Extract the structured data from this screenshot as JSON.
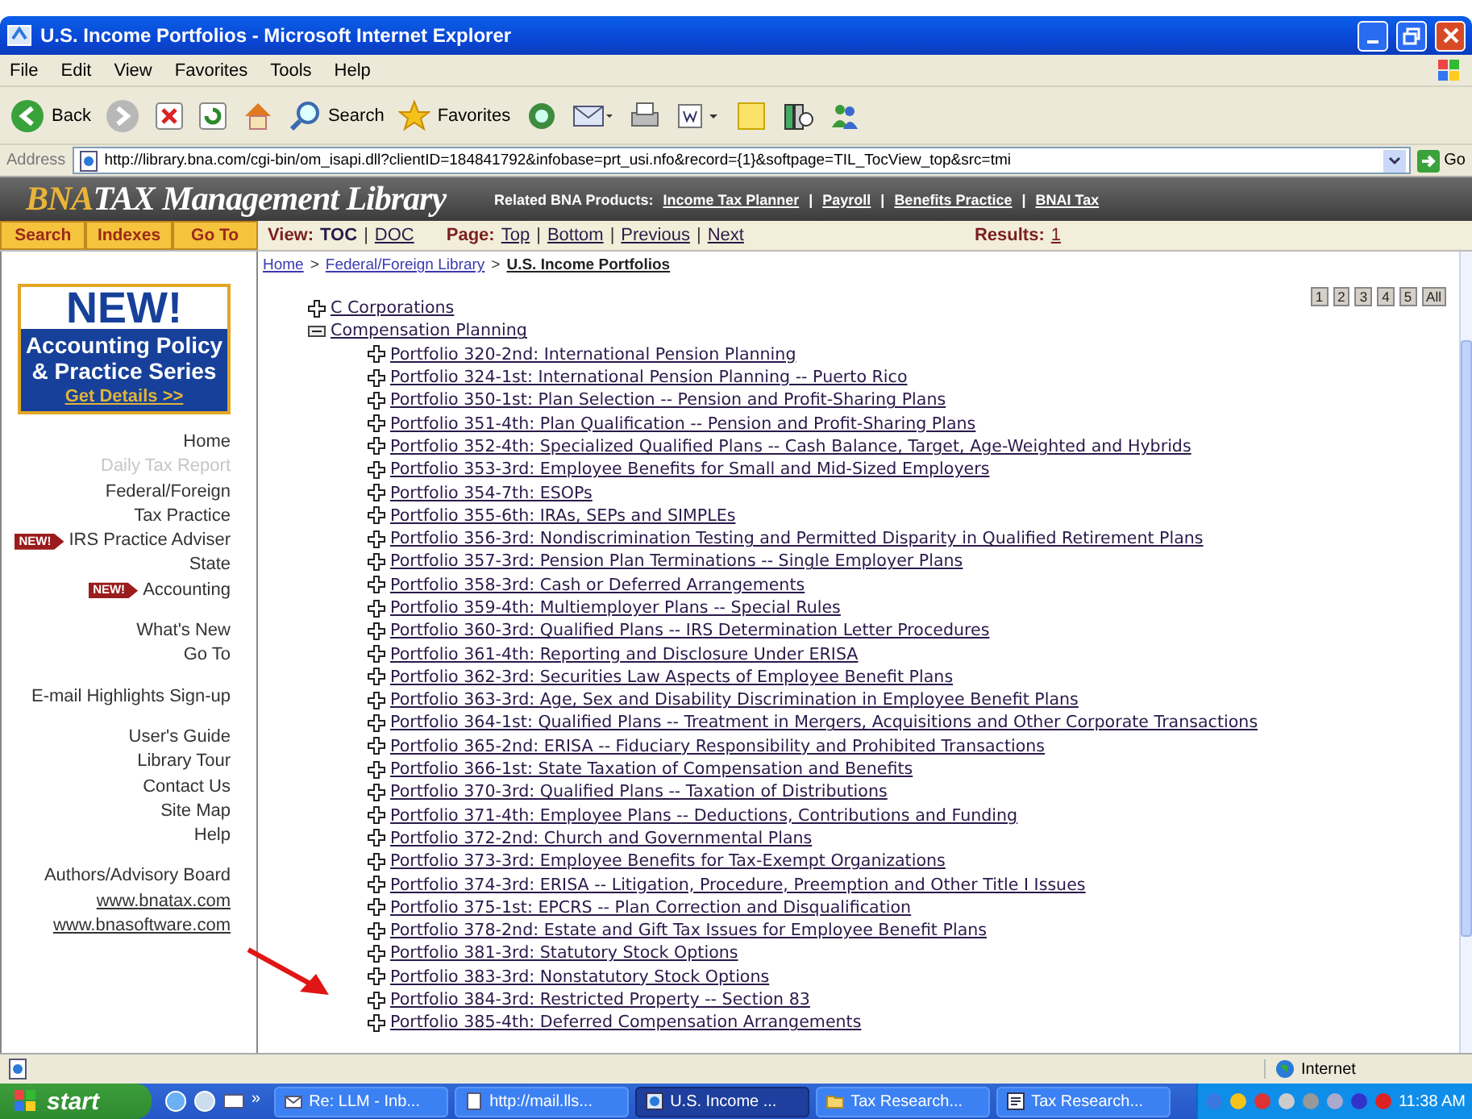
{
  "window": {
    "title": "U.S. Income Portfolios - Microsoft Internet Explorer"
  },
  "menu_bar": [
    "File",
    "Edit",
    "View",
    "Favorites",
    "Tools",
    "Help"
  ],
  "toolbar": [
    {
      "kind": "back",
      "label": "Back"
    },
    {
      "kind": "forward"
    },
    {
      "kind": "stop"
    },
    {
      "kind": "refresh"
    },
    {
      "kind": "home"
    },
    {
      "kind": "search",
      "label": "Search"
    },
    {
      "kind": "favorites",
      "label": "Favorites"
    },
    {
      "kind": "media"
    },
    {
      "kind": "mail"
    },
    {
      "kind": "print"
    },
    {
      "kind": "edit"
    },
    {
      "kind": "discuss"
    },
    {
      "kind": "research"
    },
    {
      "kind": "messenger"
    }
  ],
  "address_bar": {
    "label": "Address",
    "value": "http://library.bna.com/cgi-bin/om_isapi.dll?clientID=184841792&infobase=prt_usi.nfo&record={1}&softpage=TIL_TocView_top&src=tmi",
    "go": "Go"
  },
  "header": {
    "logo_brand": "BNA",
    "logo_name": "TAX Management Library",
    "related_label": "Related BNA Products:",
    "related_links": [
      "Income Tax Planner",
      "Payroll",
      "Benefits Practice",
      "BNAI Tax"
    ],
    "separator": "|"
  },
  "nav_bar": {
    "buttons": [
      "Search",
      "Indexes",
      "Go To"
    ],
    "view_label": "View:",
    "views": [
      {
        "label": "TOC",
        "selected": true
      },
      {
        "label": "DOC",
        "selected": false
      }
    ],
    "page_label": "Page:",
    "page_links": [
      "Top",
      "Bottom",
      "Previous",
      "Next"
    ],
    "separator": "|",
    "results_label": "Results:",
    "results_value": "1"
  },
  "breadcrumb": {
    "items": [
      "Home",
      "Federal/Foreign Library",
      "U.S. Income Portfolios"
    ],
    "separator": ">"
  },
  "sidebar": {
    "promo": {
      "headline": "NEW!",
      "title": "Accounting Policy & Practice Series",
      "link": "Get Details >>"
    },
    "groups": [
      [
        {
          "label": "Home",
          "disabled": false
        },
        {
          "label": "Daily Tax Report",
          "disabled": true
        },
        {
          "label": "Federal/Foreign",
          "disabled": false
        },
        {
          "label": "Tax Practice",
          "disabled": false
        },
        {
          "label": "IRS Practice Adviser",
          "disabled": false,
          "badge": "NEW!"
        },
        {
          "label": "State",
          "disabled": false
        },
        {
          "label": "Accounting",
          "disabled": false,
          "badge": "NEW!"
        }
      ],
      [
        {
          "label": "What's New",
          "disabled": false
        },
        {
          "label": "Go To",
          "disabled": false
        }
      ],
      [
        {
          "label": "E-mail Highlights Sign-up",
          "disabled": false
        }
      ],
      [
        {
          "label": "User's Guide",
          "disabled": false
        },
        {
          "label": "Library Tour",
          "disabled": false
        },
        {
          "label": "Contact Us",
          "disabled": false
        },
        {
          "label": "Site Map",
          "disabled": false
        },
        {
          "label": "Help",
          "disabled": false
        }
      ],
      [
        {
          "label": "Authors/Advisory Board",
          "disabled": false
        },
        {
          "label": "www.bnatax.com",
          "disabled": false,
          "kind": "link"
        },
        {
          "label": "www.bnasoftware.com",
          "disabled": false,
          "kind": "link"
        }
      ]
    ]
  },
  "page_numbers": [
    "1",
    "2",
    "3",
    "4",
    "5",
    "All"
  ],
  "tree": [
    {
      "label": "C Corporations",
      "expanded": false
    },
    {
      "label": "Compensation Planning",
      "expanded": true,
      "children": [
        {
          "label": "Portfolio 320-2nd: International Pension Planning",
          "expanded": false
        },
        {
          "label": "Portfolio 324-1st: International Pension Planning -- Puerto Rico",
          "expanded": false
        },
        {
          "label": "Portfolio 350-1st: Plan Selection -- Pension and Profit-Sharing Plans",
          "expanded": false
        },
        {
          "label": "Portfolio 351-4th: Plan Qualification -- Pension and Profit-Sharing Plans",
          "expanded": false
        },
        {
          "label": "Portfolio 352-4th: Specialized Qualified Plans -- Cash Balance, Target, Age-Weighted and Hybrids",
          "expanded": false
        },
        {
          "label": "Portfolio 353-3rd: Employee Benefits for Small and Mid-Sized Employers",
          "expanded": false
        },
        {
          "label": "Portfolio 354-7th: ESOPs",
          "expanded": false
        },
        {
          "label": "Portfolio 355-6th: IRAs, SEPs and SIMPLEs",
          "expanded": false
        },
        {
          "label": "Portfolio 356-3rd: Nondiscrimination Testing and Permitted Disparity in Qualified Retirement Plans",
          "expanded": false
        },
        {
          "label": "Portfolio 357-3rd: Pension Plan Terminations -- Single Employer Plans",
          "expanded": false
        },
        {
          "label": "Portfolio 358-3rd: Cash or Deferred Arrangements",
          "expanded": false
        },
        {
          "label": "Portfolio 359-4th: Multiemployer Plans -- Special Rules",
          "expanded": false
        },
        {
          "label": "Portfolio 360-3rd: Qualified Plans -- IRS Determination Letter Procedures",
          "expanded": false
        },
        {
          "label": "Portfolio 361-4th: Reporting and Disclosure Under ERISA",
          "expanded": false
        },
        {
          "label": "Portfolio 362-3rd: Securities Law Aspects of Employee Benefit Plans",
          "expanded": false
        },
        {
          "label": "Portfolio 363-3rd: Age, Sex and Disability Discrimination in Employee Benefit Plans",
          "expanded": false
        },
        {
          "label": "Portfolio 364-1st: Qualified Plans -- Treatment in Mergers, Acquisitions and Other Corporate Transactions",
          "expanded": false
        },
        {
          "label": "Portfolio 365-2nd: ERISA -- Fiduciary Responsibility and Prohibited Transactions",
          "expanded": false
        },
        {
          "label": "Portfolio 366-1st: State Taxation of Compensation and Benefits",
          "expanded": false
        },
        {
          "label": "Portfolio 370-3rd: Qualified Plans -- Taxation of Distributions",
          "expanded": false
        },
        {
          "label": "Portfolio 371-4th: Employee Plans -- Deductions, Contributions and Funding",
          "expanded": false
        },
        {
          "label": "Portfolio 372-2nd: Church and Governmental Plans",
          "expanded": false
        },
        {
          "label": "Portfolio 373-3rd: Employee Benefits for Tax-Exempt Organizations",
          "expanded": false
        },
        {
          "label": "Portfolio 374-3rd: ERISA -- Litigation, Procedure, Preemption and Other Title I Issues",
          "expanded": false
        },
        {
          "label": "Portfolio 375-1st: EPCRS -- Plan Correction and Disqualification",
          "expanded": false
        },
        {
          "label": "Portfolio 378-2nd: Estate and Gift Tax Issues for Employee Benefit Plans",
          "expanded": false
        },
        {
          "label": "Portfolio 381-3rd: Statutory Stock Options",
          "expanded": false
        },
        {
          "label": "Portfolio 383-3rd: Nonstatutory Stock Options",
          "expanded": false
        },
        {
          "label": "Portfolio 384-3rd: Restricted Property -- Section 83",
          "expanded": false
        },
        {
          "label": "Portfolio 385-4th: Deferred Compensation Arrangements",
          "expanded": false
        }
      ]
    }
  ],
  "status_bar": {
    "zone": "Internet"
  },
  "taskbar": {
    "start": "start",
    "more": "»",
    "tasks": [
      {
        "label": "Re: LLM - Inb...",
        "kind": "mail",
        "selected": false
      },
      {
        "label": "http://mail.lls...",
        "kind": "page",
        "selected": false
      },
      {
        "label": "U.S. Income ...",
        "kind": "ie",
        "selected": true
      },
      {
        "label": "Tax Research...",
        "kind": "folder",
        "selected": false
      },
      {
        "label": "Tax Research...",
        "kind": "doc",
        "selected": false
      }
    ],
    "clock": "11:38 AM"
  }
}
